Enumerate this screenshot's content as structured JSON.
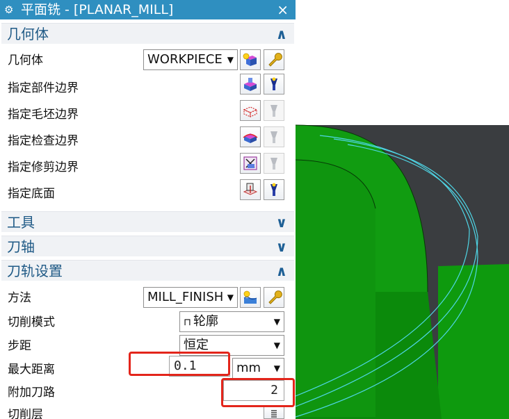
{
  "window": {
    "title": "平面铣 - [PLANAR_MILL]",
    "title_icon": "gear-icon",
    "close_symbol": "×"
  },
  "geometry_section": {
    "heading": "几何体",
    "expanded": true,
    "geometry_label": "几何体",
    "geometry_value": "WORKPIECE",
    "rows": [
      {
        "label": "指定部件边界"
      },
      {
        "label": "指定毛坯边界"
      },
      {
        "label": "指定检查边界"
      },
      {
        "label": "指定修剪边界"
      },
      {
        "label": "指定底面"
      }
    ]
  },
  "tool_section": {
    "heading": "工具",
    "expanded": false
  },
  "axis_section": {
    "heading": "刀轴",
    "expanded": false
  },
  "path_section": {
    "heading": "刀轨设置",
    "expanded": true,
    "method_label": "方法",
    "method_value": "MILL_FINISH",
    "cut_pattern_label": "切削模式",
    "cut_pattern_value": "轮廓",
    "stepover_label": "步距",
    "stepover_value": "恒定",
    "max_distance_label": "最大距离",
    "max_distance_value": "0.1",
    "unit_value": "mm",
    "additional_passes_label": "附加刀路",
    "additional_passes_value": "2",
    "cut_levels_label": "切削层"
  },
  "colors": {
    "title_bar": "#2f8fc0",
    "section_text": "#1f5a86",
    "highlight_box": "#e3251b",
    "model_green": "#0e9a0e",
    "toolpath": "#4fd6e6",
    "background_dark": "#3a3d40"
  }
}
